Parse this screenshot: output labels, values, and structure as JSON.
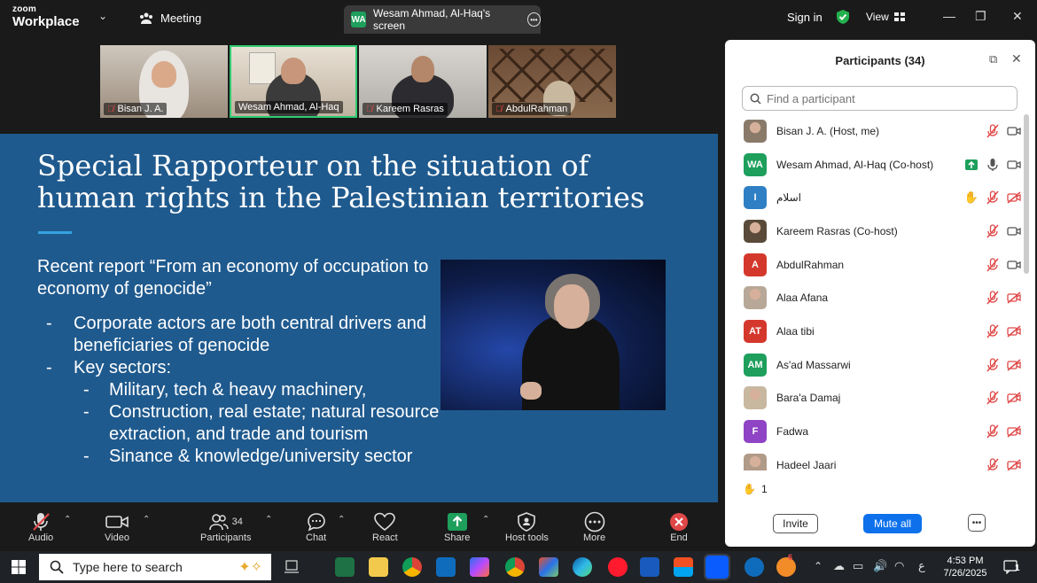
{
  "app": {
    "logo_top": "zoom",
    "logo_bottom": "Workplace",
    "meeting_label": "Meeting",
    "screen_tab_badge": "WA",
    "screen_tab_label": "Wesam Ahmad, Al-Haq's screen",
    "sign_in": "Sign in",
    "view_label": "View"
  },
  "thumbnails": [
    {
      "name": "Bisan J. A.",
      "active": false
    },
    {
      "name": "Wesam Ahmad, Al-Haq",
      "active": true
    },
    {
      "name": "Kareem Rasras",
      "active": false
    },
    {
      "name": "AbdulRahman",
      "active": false
    }
  ],
  "slide": {
    "title": "Special Rapporteur on the situation of human rights in the Palestinian territories",
    "intro": "Recent report “From an economy of occupation to economy of genocide”",
    "bullet1": "Corporate actors are both central drivers and beneficiaries of genocide",
    "bullet2": "Key sectors:",
    "sub1": "Military, tech & heavy machinery,",
    "sub2": "Construction, real estate; natural resource extraction, and trade and tourism",
    "sub3": "Sinance & knowledge/university sector"
  },
  "panel": {
    "title": "Participants (34)",
    "search_placeholder": "Find a participant",
    "raised_hands": "1",
    "invite": "Invite",
    "mute_all": "Mute all",
    "participants": [
      {
        "name": "Bisan J. A. (Host, me)",
        "avatar": "",
        "color": "#8a7a6a",
        "photo": true,
        "video": "on",
        "hand": false,
        "share": false,
        "mic": "muted"
      },
      {
        "name": "Wesam Ahmad, Al-Haq (Co-host)",
        "avatar": "WA",
        "color": "#1e9f5c",
        "photo": false,
        "video": "on",
        "hand": false,
        "share": true,
        "mic": "on"
      },
      {
        "name": "اسلام",
        "avatar": "I",
        "color": "#2f7fc4",
        "photo": false,
        "video": "off",
        "hand": true,
        "share": false,
        "mic": "muted"
      },
      {
        "name": "Kareem Rasras (Co-host)",
        "avatar": "",
        "color": "#5a4a3a",
        "photo": true,
        "video": "on",
        "hand": false,
        "share": false,
        "mic": "muted"
      },
      {
        "name": "AbdulRahman",
        "avatar": "A",
        "color": "#d4382c",
        "photo": false,
        "video": "on",
        "hand": false,
        "share": false,
        "mic": "muted"
      },
      {
        "name": "Alaa Afana",
        "avatar": "",
        "color": "#b8a898",
        "photo": true,
        "video": "off",
        "hand": false,
        "share": false,
        "mic": "muted"
      },
      {
        "name": "Alaa tibi",
        "avatar": "AT",
        "color": "#d4382c",
        "photo": false,
        "video": "off",
        "hand": false,
        "share": false,
        "mic": "muted"
      },
      {
        "name": "As'ad Massarwi",
        "avatar": "AM",
        "color": "#1e9f5c",
        "photo": false,
        "video": "off",
        "hand": false,
        "share": false,
        "mic": "muted"
      },
      {
        "name": "Bara'a Damaj",
        "avatar": "",
        "color": "#c8b8a0",
        "photo": true,
        "video": "off",
        "hand": false,
        "share": false,
        "mic": "muted"
      },
      {
        "name": "Fadwa",
        "avatar": "F",
        "color": "#8e44c4",
        "photo": false,
        "video": "off",
        "hand": false,
        "share": false,
        "mic": "muted"
      },
      {
        "name": "Hadeel Jaari",
        "avatar": "",
        "color": "#b09a88",
        "photo": true,
        "video": "off",
        "hand": false,
        "share": false,
        "mic": "muted"
      }
    ]
  },
  "toolbar": {
    "audio": "Audio",
    "video": "Video",
    "participants": "Participants",
    "participants_count": "34",
    "chat": "Chat",
    "react": "React",
    "share": "Share",
    "host_tools": "Host tools",
    "more": "More",
    "end": "End"
  },
  "taskbar": {
    "search_placeholder": "Type here to search",
    "time": "4:53 PM",
    "date": "7/26/2025",
    "notification_count": "1",
    "badge_count": "6",
    "lang": "ع"
  },
  "colors": {
    "slide_bg": "#1f5a8e",
    "accent_blue": "#0e71eb",
    "active_green": "#2ecc71",
    "end_red": "#e04848"
  }
}
